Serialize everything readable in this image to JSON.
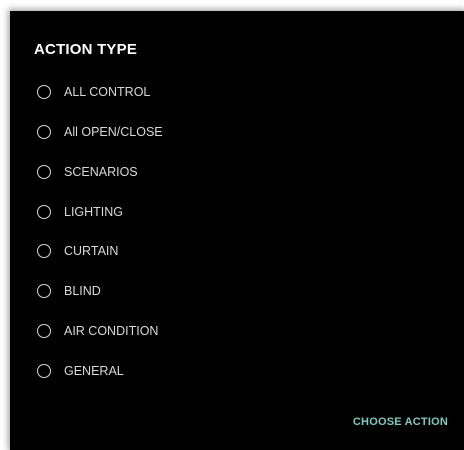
{
  "dialog": {
    "title": "ACTION TYPE",
    "options": [
      {
        "label": "ALL CONTROL",
        "selected": false
      },
      {
        "label": "All OPEN/CLOSE",
        "selected": false
      },
      {
        "label": "SCENARIOS",
        "selected": false
      },
      {
        "label": "LIGHTING",
        "selected": false
      },
      {
        "label": "CURTAIN",
        "selected": false
      },
      {
        "label": "BLIND",
        "selected": false
      },
      {
        "label": "AIR CONDITION",
        "selected": false
      },
      {
        "label": "GENERAL",
        "selected": false
      }
    ],
    "choose_action_label": "CHOOSE ACTION"
  },
  "colors": {
    "dialog_background": "#000000",
    "title_text": "#ffffff",
    "option_text": "#d9d9d9",
    "radio_border": "#d7d7d7",
    "accent": "#7fc9c1"
  }
}
